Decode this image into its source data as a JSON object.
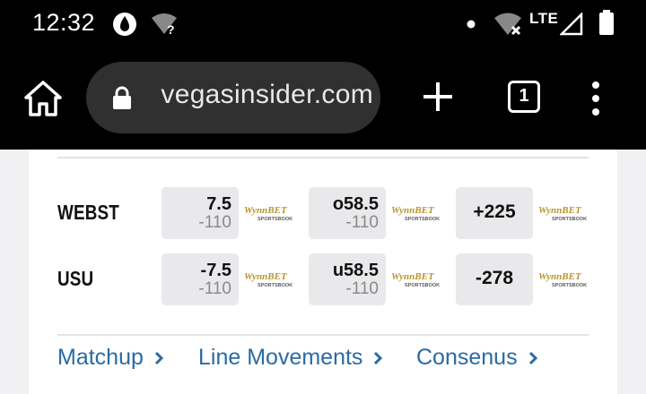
{
  "status_bar": {
    "time": "12:32",
    "network": "LTE",
    "icons": [
      "data-saver-icon",
      "wifi-unknown-icon",
      "dot-icon",
      "wifi-off-icon",
      "lte-icon",
      "signal-icon",
      "battery-icon"
    ]
  },
  "browser": {
    "url": "vegasinsider.com",
    "tab_count": "1",
    "icons": [
      "home-icon",
      "lock-icon",
      "plus-icon",
      "tabs-icon",
      "more-vert-icon"
    ]
  },
  "odds_table": {
    "rows": [
      {
        "team": "WEBST",
        "spread": {
          "line": "7.5",
          "price": "-110"
        },
        "total": {
          "line": "o58.5",
          "price": "-110"
        },
        "moneyline": "+225"
      },
      {
        "team": "USU",
        "spread": {
          "line": "-7.5",
          "price": "-110"
        },
        "total": {
          "line": "u58.5",
          "price": "-110"
        },
        "moneyline": "-278"
      }
    ],
    "sportsbook": {
      "name": "WynnBET",
      "tagline": "SPORTSBOOK",
      "color": "#b8962e"
    }
  },
  "links": {
    "matchup": "Matchup",
    "line_movements": "Line Movements",
    "consensus": "Consenus",
    "color": "#2b6aa3"
  }
}
